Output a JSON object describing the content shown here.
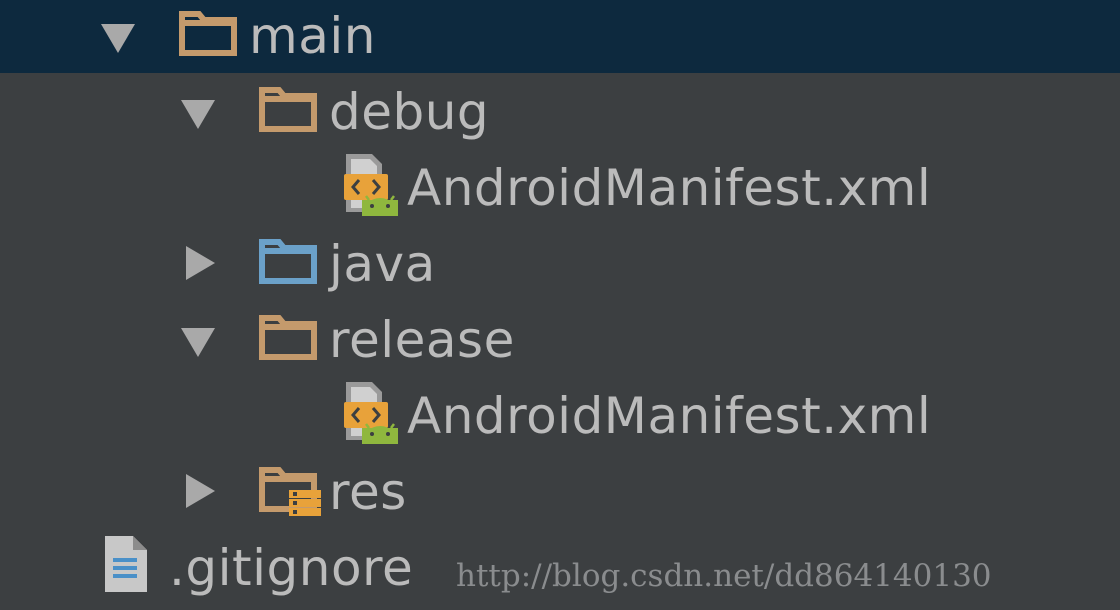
{
  "project_tree": {
    "items": [
      {
        "label": "main",
        "state": "expanded",
        "icon": "folder-icon",
        "selected": true
      },
      {
        "label": "debug",
        "state": "expanded",
        "icon": "folder-icon"
      },
      {
        "label": "AndroidManifest.xml",
        "icon": "android-manifest-icon"
      },
      {
        "label": "java",
        "state": "collapsed",
        "icon": "source-folder-icon"
      },
      {
        "label": "release",
        "state": "expanded",
        "icon": "folder-icon"
      },
      {
        "label": "AndroidManifest.xml",
        "icon": "android-manifest-icon"
      },
      {
        "label": "res",
        "state": "collapsed",
        "icon": "resource-folder-icon"
      },
      {
        "label": ".gitignore",
        "icon": "text-file-icon"
      }
    ]
  },
  "watermark": {
    "text": "http://blog.csdn.net/dd864140130"
  },
  "colors": {
    "background": "#3c3f41",
    "selection": "#0d293e",
    "text": "#bbbbbb",
    "folder": "#c49a6c",
    "source_folder": "#6ba1c9",
    "android_green": "#8fb73e"
  }
}
